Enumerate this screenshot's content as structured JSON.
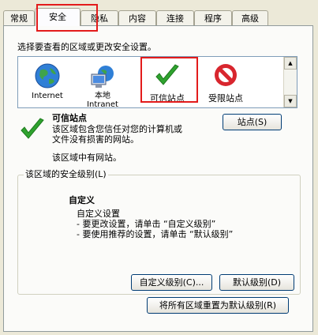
{
  "tabs": [
    {
      "label": "常规"
    },
    {
      "label": "安全"
    },
    {
      "label": "隐私"
    },
    {
      "label": "内容"
    },
    {
      "label": "连接"
    },
    {
      "label": "程序"
    },
    {
      "label": "高级"
    }
  ],
  "instruction": "选择要查看的区域或更改安全设置。",
  "zones": [
    {
      "label": "Internet",
      "icon": "globe-icon"
    },
    {
      "label": "本地\nIntranet",
      "icon": "intranet-icon"
    },
    {
      "label": "可信站点",
      "icon": "checkmark-icon"
    },
    {
      "label": "受限站点",
      "icon": "restricted-icon"
    }
  ],
  "selected_zone": {
    "title": "可信站点",
    "description_line1": "该区域包含您信任对您的计算机或",
    "description_line2": "文件没有损害的网站。",
    "note": "该区域中有网站。",
    "sites_button": "站点(S)"
  },
  "security_level": {
    "group_label": "该区域的安全级别(L)",
    "level_title": "自定义",
    "line1": "自定义设置",
    "line2": "- 要更改设置，请单击 “自定义级别”",
    "line3": "- 要使用推荐的设置，请单击 “默认级别”",
    "custom_button": "自定义级别(C)...",
    "default_button": "默认级别(D)"
  },
  "reset_button": "将所有区域重置为默认级别(R)",
  "colors": {
    "highlight_box": "#e31b1b",
    "check_green": "#2fa32f",
    "restricted_red": "#d8262e"
  }
}
